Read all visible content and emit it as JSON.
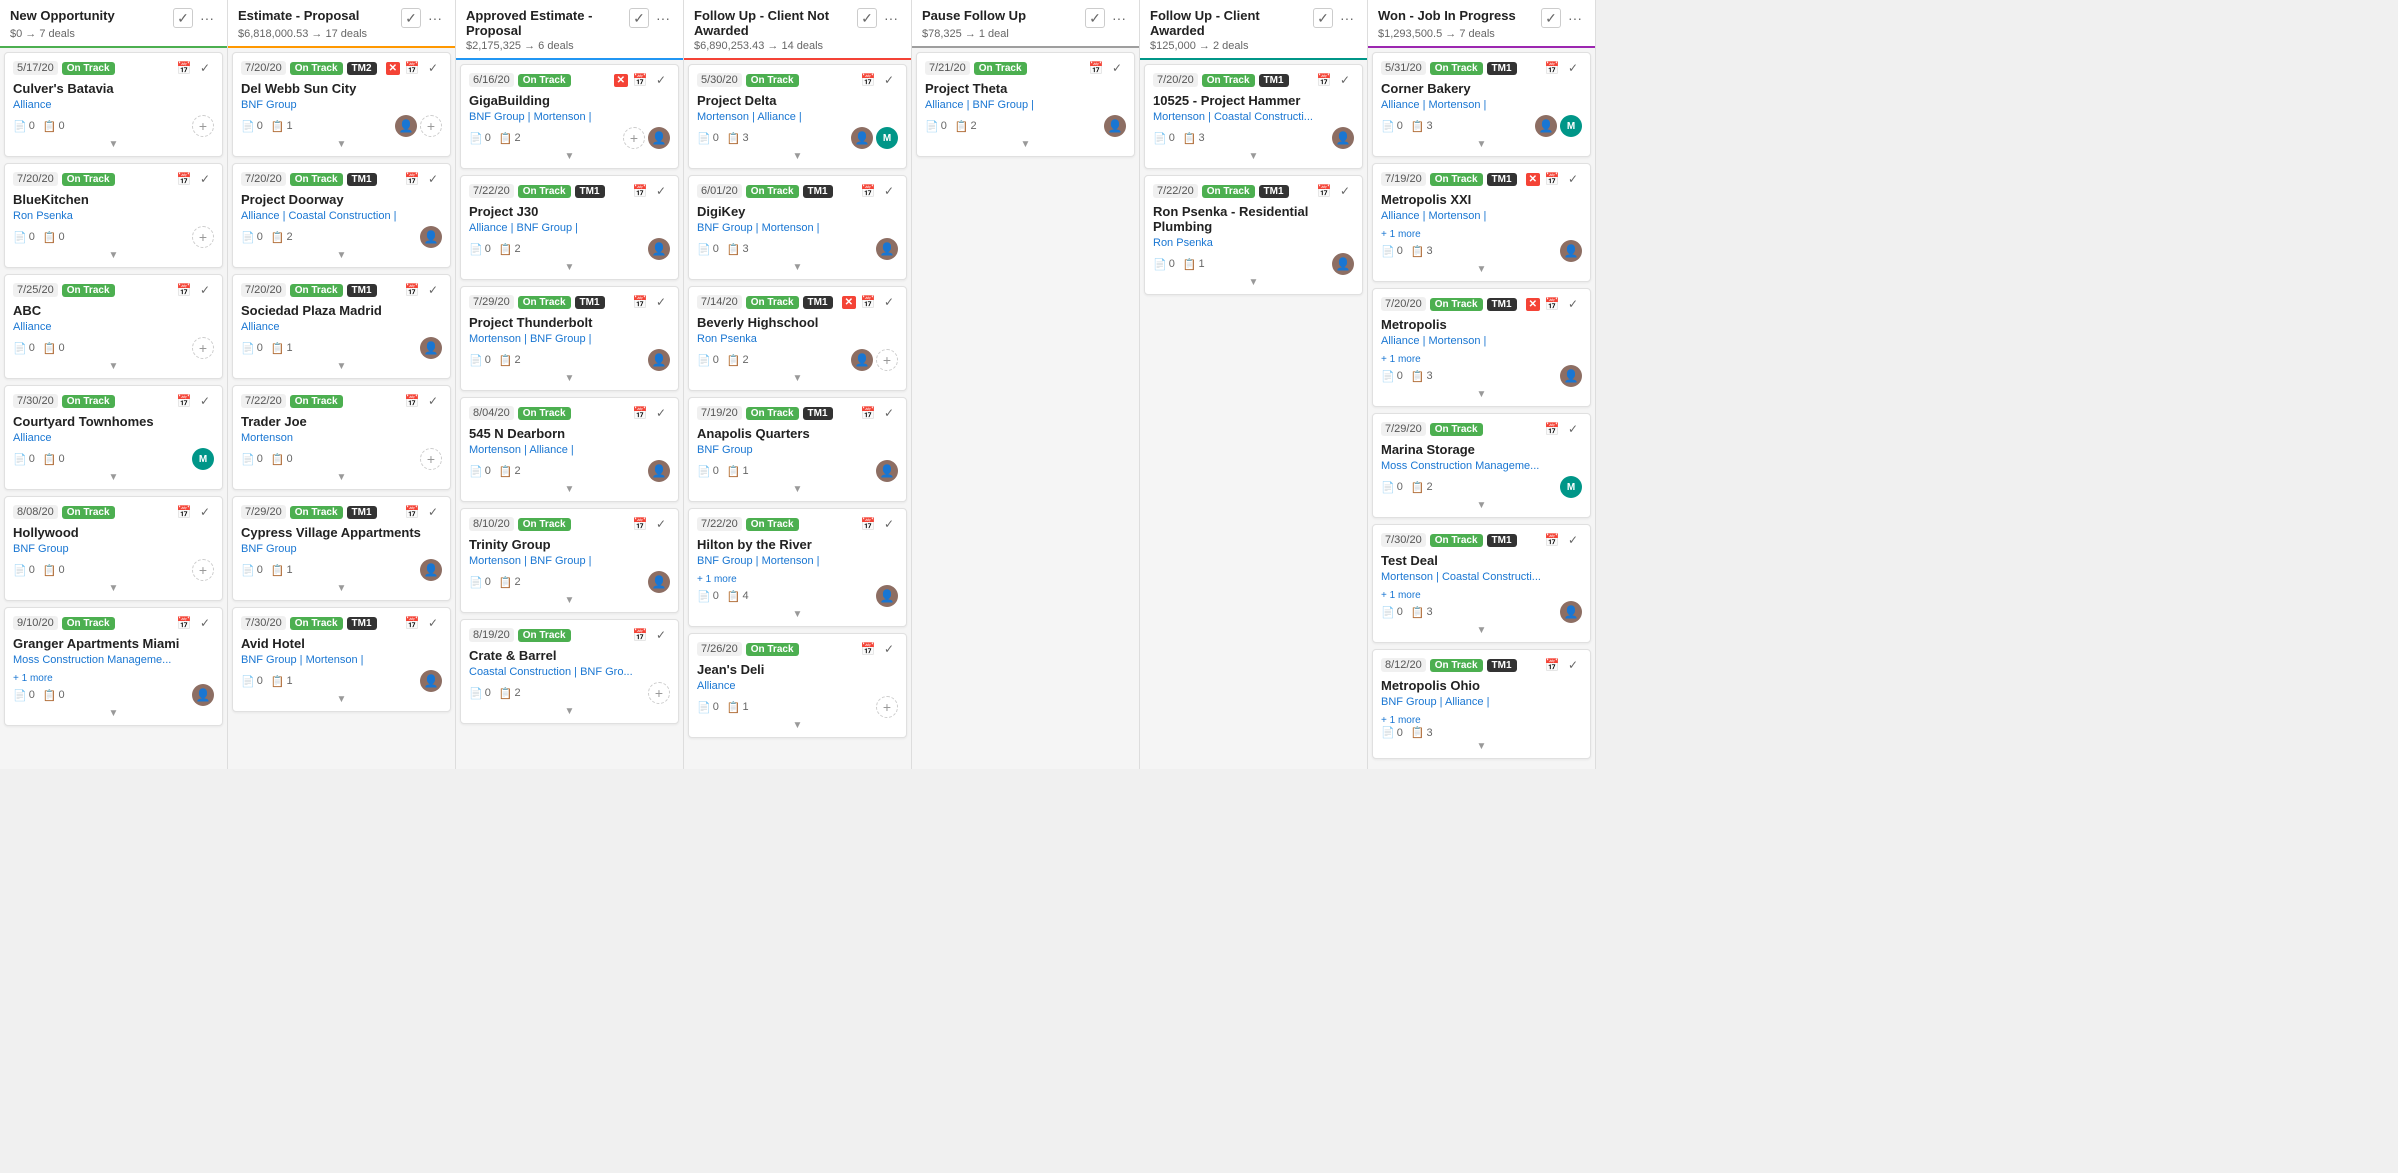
{
  "columns": [
    {
      "id": "new-opportunity",
      "title": "New Opportunity",
      "subtitle": "$0 → 7 deals",
      "color": "green",
      "cards": [
        {
          "date": "5/17/20",
          "ontrack": true,
          "tm": null,
          "xcross": false,
          "name": "Culver's Batavia",
          "company": "Alliance",
          "companies_extra": null,
          "docs": 0,
          "files": 0,
          "avatars": [
            "person"
          ],
          "extra_count": null
        },
        {
          "date": "7/20/20",
          "ontrack": true,
          "tm": null,
          "xcross": false,
          "name": "BlueKitchen",
          "company": "Ron Psenka",
          "companies_extra": null,
          "docs": 0,
          "files": 0,
          "avatars": [
            "person"
          ],
          "extra_count": null
        },
        {
          "date": "7/25/20",
          "ontrack": true,
          "tm": null,
          "xcross": false,
          "name": "ABC",
          "company": "Alliance",
          "companies_extra": null,
          "docs": 0,
          "files": 0,
          "avatars": [
            "person"
          ],
          "extra_count": null
        },
        {
          "date": "7/30/20",
          "ontrack": true,
          "tm": null,
          "xcross": false,
          "name": "Courtyard Townhomes",
          "company": "Alliance",
          "companies_extra": null,
          "docs": 0,
          "files": 0,
          "avatars": [
            "teal"
          ],
          "extra_count": null
        },
        {
          "date": "8/08/20",
          "ontrack": true,
          "tm": null,
          "xcross": false,
          "name": "Hollywood",
          "company": "BNF Group",
          "companies_extra": null,
          "docs": 0,
          "files": 0,
          "avatars": [
            "person"
          ],
          "extra_count": null
        },
        {
          "date": "9/10/20",
          "ontrack": true,
          "tm": null,
          "xcross": false,
          "name": "Granger Apartments Miami",
          "company": "Moss Construction Manageme...",
          "companies_extra": "+ 1 more",
          "docs": 0,
          "files": 0,
          "avatars": [
            "brown"
          ],
          "extra_count": null
        }
      ]
    },
    {
      "id": "estimate-proposal",
      "title": "Estimate - Proposal",
      "subtitle": "$6,818,000.53 → 17 deals",
      "color": "orange",
      "cards": [
        {
          "date": "7/20/20",
          "ontrack": true,
          "tm": "TM2",
          "xcross": true,
          "name": "Del Webb Sun City",
          "company": "BNF Group",
          "companies_extra": null,
          "docs": 0,
          "files": 1,
          "avatars": [
            "brown",
            "person"
          ],
          "extra_count": null
        },
        {
          "date": "7/20/20",
          "ontrack": true,
          "tm": "TM1",
          "xcross": false,
          "name": "Project Doorway",
          "company": "Alliance | Coastal Construction |",
          "companies_extra": null,
          "docs": 0,
          "files": 2,
          "avatars": [
            "brown"
          ],
          "extra_count": null
        },
        {
          "date": "7/20/20",
          "ontrack": true,
          "tm": "TM1",
          "xcross": false,
          "name": "Sociedad Plaza Madrid",
          "company": "Alliance",
          "companies_extra": null,
          "docs": 0,
          "files": 1,
          "avatars": [
            "brown"
          ],
          "extra_count": null
        },
        {
          "date": "7/22/20",
          "ontrack": true,
          "tm": null,
          "xcross": false,
          "name": "Trader Joe",
          "company": "Mortenson",
          "companies_extra": null,
          "docs": 0,
          "files": 0,
          "avatars": [
            "person"
          ],
          "extra_count": null
        },
        {
          "date": "7/29/20",
          "ontrack": true,
          "tm": "TM1",
          "xcross": false,
          "name": "Cypress Village Appartments",
          "company": "BNF Group",
          "companies_extra": null,
          "docs": 0,
          "files": 1,
          "avatars": [
            "brown"
          ],
          "extra_count": null
        },
        {
          "date": "7/30/20",
          "ontrack": true,
          "tm": "TM1",
          "xcross": false,
          "name": "Avid Hotel",
          "company": "BNF Group | Mortenson |",
          "companies_extra": null,
          "docs": 0,
          "files": 1,
          "avatars": [
            "brown"
          ],
          "extra_count": null
        }
      ]
    },
    {
      "id": "approved-estimate",
      "title": "Approved Estimate - Proposal",
      "subtitle": "$2,175,325 → 6 deals",
      "color": "blue",
      "cards": [
        {
          "date": "6/16/20",
          "ontrack": true,
          "tm": null,
          "xcross": true,
          "name": "GigaBuilding",
          "company": "BNF Group | Mortenson |",
          "companies_extra": null,
          "docs": 0,
          "files": 2,
          "avatars": [
            "person",
            "brown"
          ],
          "extra_count": null
        },
        {
          "date": "7/22/20",
          "ontrack": true,
          "tm": "TM1",
          "xcross": false,
          "name": "Project J30",
          "company": "Alliance | BNF Group |",
          "companies_extra": null,
          "docs": 0,
          "files": 2,
          "avatars": [
            "brown"
          ],
          "extra_count": null
        },
        {
          "date": "7/29/20",
          "ontrack": true,
          "tm": "TM1",
          "xcross": false,
          "name": "Project Thunderbolt",
          "company": "Mortenson | BNF Group |",
          "companies_extra": null,
          "docs": 0,
          "files": 2,
          "avatars": [
            "brown"
          ],
          "extra_count": null
        },
        {
          "date": "8/04/20",
          "ontrack": true,
          "tm": null,
          "xcross": false,
          "name": "545 N Dearborn",
          "company": "Mortenson | Alliance |",
          "companies_extra": null,
          "docs": 0,
          "files": 2,
          "avatars": [
            "brown"
          ],
          "extra_count": null
        },
        {
          "date": "8/10/20",
          "ontrack": true,
          "tm": null,
          "xcross": false,
          "name": "Trinity Group",
          "company": "Mortenson | BNF Group |",
          "companies_extra": null,
          "docs": 0,
          "files": 2,
          "avatars": [
            "brown"
          ],
          "extra_count": null
        },
        {
          "date": "8/19/20",
          "ontrack": true,
          "tm": null,
          "xcross": false,
          "name": "Crate & Barrel",
          "company": "Coastal Construction | BNF Gro...",
          "companies_extra": null,
          "docs": 0,
          "files": 2,
          "avatars": [
            "person"
          ],
          "extra_count": null
        }
      ]
    },
    {
      "id": "followup-not-awarded",
      "title": "Follow Up - Client Not Awarded",
      "subtitle": "$6,890,253.43 → 14 deals",
      "color": "red",
      "cards": [
        {
          "date": "5/30/20",
          "ontrack": true,
          "tm": null,
          "xcross": false,
          "name": "Project Delta",
          "company": "Mortenson | Alliance |",
          "companies_extra": null,
          "docs": 0,
          "files": 3,
          "avatars": [
            "brown",
            "teal"
          ],
          "extra_count": null
        },
        {
          "date": "6/01/20",
          "ontrack": true,
          "tm": "TM1",
          "xcross": false,
          "name": "DigiKey",
          "company": "BNF Group | Mortenson |",
          "companies_extra": null,
          "docs": 0,
          "files": 3,
          "avatars": [
            "brown"
          ],
          "extra_count": null
        },
        {
          "date": "7/14/20",
          "ontrack": true,
          "tm": "TM1",
          "xcross": true,
          "name": "Beverly Highschool",
          "company": "Ron Psenka",
          "companies_extra": null,
          "docs": 0,
          "files": 2,
          "avatars": [
            "brown",
            "person"
          ],
          "extra_count": null
        },
        {
          "date": "7/19/20",
          "ontrack": true,
          "tm": "TM1",
          "xcross": false,
          "name": "Anapolis Quarters",
          "company": "BNF Group",
          "companies_extra": null,
          "docs": 0,
          "files": 1,
          "avatars": [
            "brown"
          ],
          "extra_count": null
        },
        {
          "date": "7/22/20",
          "ontrack": true,
          "tm": null,
          "xcross": false,
          "name": "Hilton by the River",
          "company": "BNF Group | Mortenson |",
          "companies_extra": "+ 1 more",
          "docs": 0,
          "files": 4,
          "avatars": [
            "brown"
          ],
          "extra_count": null
        },
        {
          "date": "7/26/20",
          "ontrack": true,
          "tm": null,
          "xcross": false,
          "name": "Jean's Deli",
          "company": "Alliance",
          "companies_extra": null,
          "docs": 0,
          "files": 1,
          "avatars": [
            "person"
          ],
          "extra_count": null
        }
      ]
    },
    {
      "id": "pause-followup",
      "title": "Pause Follow Up",
      "subtitle": "$78,325 → 1 deal",
      "color": "gray",
      "cards": [
        {
          "date": "7/21/20",
          "ontrack": true,
          "tm": null,
          "xcross": false,
          "name": "Project Theta",
          "company": "Alliance | BNF Group |",
          "companies_extra": null,
          "docs": 0,
          "files": 2,
          "avatars": [
            "brown"
          ],
          "extra_count": null
        }
      ]
    },
    {
      "id": "followup-awarded",
      "title": "Follow Up - Client Awarded",
      "subtitle": "$125,000 → 2 deals",
      "color": "teal",
      "cards": [
        {
          "date": "7/20/20",
          "ontrack": true,
          "tm": "TM1",
          "xcross": false,
          "name": "10525 - Project Hammer",
          "company": "Mortenson | Coastal Constructi...",
          "companies_extra": null,
          "docs": 0,
          "files": 3,
          "avatars": [
            "brown"
          ],
          "extra_count": null
        },
        {
          "date": "7/22/20",
          "ontrack": true,
          "tm": "TM1",
          "xcross": false,
          "name": "Ron Psenka - Residential Plumbing",
          "company": "Ron Psenka",
          "companies_extra": null,
          "docs": 0,
          "files": 1,
          "avatars": [
            "brown"
          ],
          "extra_count": null
        }
      ]
    },
    {
      "id": "won-job-in-progress",
      "title": "Won - Job In Progress",
      "subtitle": "$1,293,500.5 → 7 deals",
      "color": "purple",
      "cards": [
        {
          "date": "5/31/20",
          "ontrack": true,
          "tm": "TM1",
          "xcross": false,
          "name": "Corner Bakery",
          "company": "Alliance | Mortenson |",
          "companies_extra": null,
          "docs": 0,
          "files": 3,
          "avatars": [
            "brown",
            "teal"
          ],
          "extra_count": null
        },
        {
          "date": "7/19/20",
          "ontrack": true,
          "tm": "TM1",
          "xcross": true,
          "name": "Metropolis XXI",
          "company": "Alliance | Mortenson |",
          "companies_extra": "+ 1 more",
          "docs": 0,
          "files": 3,
          "avatars": [
            "brown"
          ],
          "extra_count": null
        },
        {
          "date": "7/20/20",
          "ontrack": true,
          "tm": "TM1",
          "xcross": true,
          "name": "Metropolis",
          "company": "Alliance | Mortenson |",
          "companies_extra": "+ 1 more",
          "docs": 0,
          "files": 3,
          "avatars": [
            "brown"
          ],
          "extra_count": null
        },
        {
          "date": "7/29/20",
          "ontrack": true,
          "tm": null,
          "xcross": false,
          "name": "Marina Storage",
          "company": "Moss Construction Manageme...",
          "companies_extra": null,
          "docs": 0,
          "files": 2,
          "avatars": [
            "teal"
          ],
          "extra_count": null
        },
        {
          "date": "7/30/20",
          "ontrack": true,
          "tm": "TM1",
          "xcross": false,
          "name": "Test Deal",
          "company": "Mortenson | Coastal Constructi...",
          "companies_extra": "+ 1 more",
          "docs": 0,
          "files": 3,
          "avatars": [
            "brown"
          ],
          "extra_count": null
        },
        {
          "date": "8/12/20",
          "ontrack": true,
          "tm": "TM1",
          "xcross": false,
          "name": "Metropolis Ohio",
          "company": "BNF Group | Alliance |",
          "companies_extra": "+ 1 more",
          "docs": 0,
          "files": 3,
          "avatars": [],
          "extra_count": null
        }
      ]
    }
  ],
  "labels": {
    "on_track": "On Track",
    "expand": "▼",
    "docs_icon": "📄",
    "file_icon": "📋"
  }
}
